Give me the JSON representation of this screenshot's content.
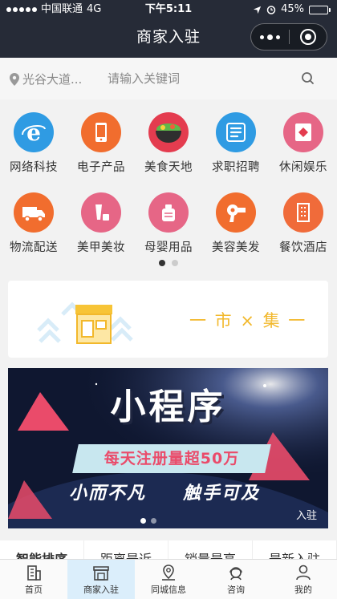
{
  "status_bar": {
    "carrier": "中国联通",
    "network": "4G",
    "time": "下午5:11",
    "battery": "45%",
    "battery_level": 0.45
  },
  "nav": {
    "title": "商家入驻"
  },
  "search": {
    "location": "光谷大道...",
    "placeholder": "请输入关键词"
  },
  "categories": [
    {
      "label": "网络科技",
      "icon": "ie-browser-icon",
      "color": "#2f9be3"
    },
    {
      "label": "电子产品",
      "icon": "smartphone-icon",
      "color": "#f16d2e"
    },
    {
      "label": "美食天地",
      "icon": "food-bowl-icon",
      "color": "#e43c4f"
    },
    {
      "label": "求职招聘",
      "icon": "recruit-icon",
      "color": "#2f9be3"
    },
    {
      "label": "休闲娱乐",
      "icon": "card-icon",
      "color": "#e66686"
    },
    {
      "label": "物流配送",
      "icon": "delivery-truck-icon",
      "color": "#f16d2e"
    },
    {
      "label": "美甲美妆",
      "icon": "cosmetics-icon",
      "color": "#e66686"
    },
    {
      "label": "母婴用品",
      "icon": "baby-bottle-icon",
      "color": "#e66686"
    },
    {
      "label": "美容美发",
      "icon": "hair-dryer-icon",
      "color": "#f16d2e"
    },
    {
      "label": "餐饮酒店",
      "icon": "hotel-building-icon",
      "color": "#f06b3a"
    }
  ],
  "pager": {
    "pages": 2,
    "active": 0
  },
  "market_banner": {
    "text": "一 市 × 集 一"
  },
  "promo_banner": {
    "title": "小程序",
    "subtitle": "每天注册量超50万",
    "tagline_left": "小而不凡",
    "tagline_right": "触手可及",
    "corner_label": "入驻"
  },
  "filter_tabs": [
    {
      "label": "智能排序",
      "active": true
    },
    {
      "label": "距离最近",
      "active": false
    },
    {
      "label": "销量最高",
      "active": false
    },
    {
      "label": "最新入驻",
      "active": false
    }
  ],
  "tabbar": [
    {
      "label": "首页",
      "icon": "home-building-icon",
      "active": false
    },
    {
      "label": "商家入驻",
      "icon": "store-icon",
      "active": true
    },
    {
      "label": "同城信息",
      "icon": "location-pin-icon",
      "active": false
    },
    {
      "label": "咨询",
      "icon": "customer-service-icon",
      "active": false
    },
    {
      "label": "我的",
      "icon": "user-icon",
      "active": false
    }
  ]
}
